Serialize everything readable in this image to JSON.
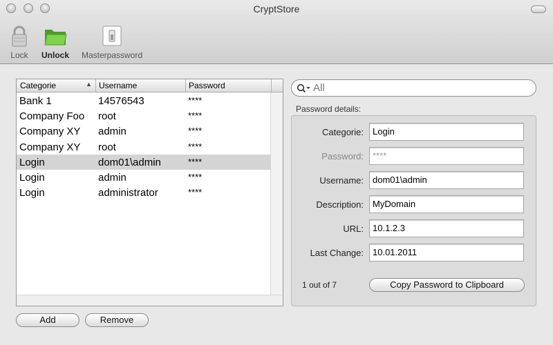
{
  "window": {
    "title": "CryptStore"
  },
  "toolbar": {
    "lock_label": "Lock",
    "unlock_label": "Unlock",
    "master_label": "Masterpassword"
  },
  "table": {
    "columns": [
      "Categorie",
      "Username",
      "Password"
    ],
    "rows": [
      {
        "categorie": "Bank 1",
        "username": "14576543",
        "password": "****"
      },
      {
        "categorie": "Company Foo",
        "username": "root",
        "password": "****"
      },
      {
        "categorie": "Company XY",
        "username": "admin",
        "password": "****"
      },
      {
        "categorie": "Company XY",
        "username": "root",
        "password": "****"
      },
      {
        "categorie": "Login",
        "username": "dom01\\admin",
        "password": "****"
      },
      {
        "categorie": "Login",
        "username": "admin",
        "password": "****"
      },
      {
        "categorie": "Login",
        "username": "administrator",
        "password": "****"
      }
    ],
    "selected_row": 4,
    "sort_column": "Categorie"
  },
  "buttons": {
    "add": "Add",
    "remove": "Remove",
    "copy": "Copy Password to Clipboard"
  },
  "search": {
    "placeholder": "All"
  },
  "details": {
    "group_label": "Password details:",
    "labels": {
      "categorie": "Categorie:",
      "password": "Password:",
      "username": "Username:",
      "description": "Description:",
      "url": "URL:",
      "last_change": "Last Change:"
    },
    "values": {
      "categorie": "Login",
      "password": "****",
      "username": "dom01\\admin",
      "description": "MyDomain",
      "url": "10.1.2.3",
      "last_change": "10.01.2011"
    },
    "record_count": "1 out of 7"
  },
  "colors": {
    "selection": "#d4d4d4",
    "window_bg": "#e8e8e8",
    "folder_green": "#6ac13a"
  }
}
